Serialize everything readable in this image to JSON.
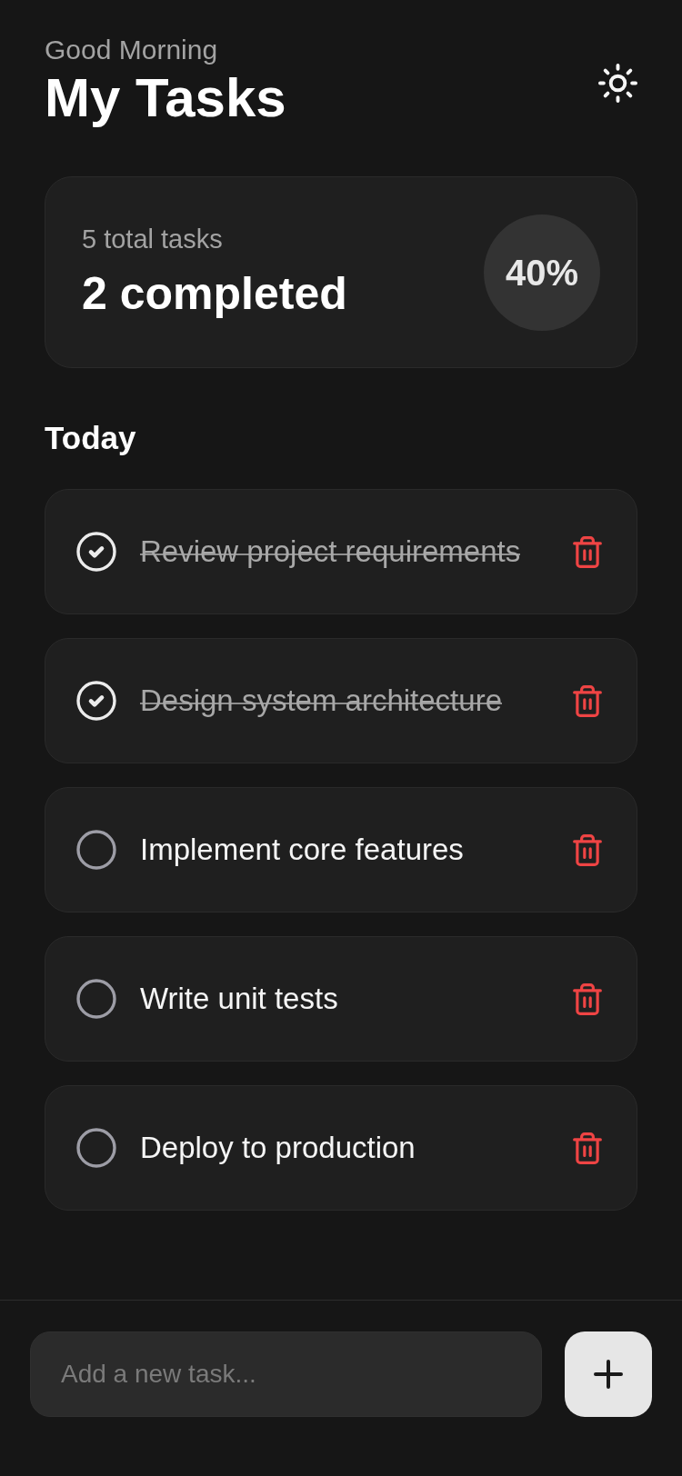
{
  "header": {
    "greeting": "Good Morning",
    "title": "My Tasks"
  },
  "summary": {
    "total": "5 total tasks",
    "completed": "2 completed",
    "percent": "40%"
  },
  "section": {
    "title": "Today"
  },
  "tasks": [
    {
      "text": "Review project requirements",
      "checked": true
    },
    {
      "text": "Design system architecture",
      "checked": true
    },
    {
      "text": "Implement core features",
      "checked": false
    },
    {
      "text": "Write unit tests",
      "checked": false
    },
    {
      "text": "Deploy to production",
      "checked": false
    }
  ],
  "composer": {
    "placeholder": "Add a new task..."
  }
}
